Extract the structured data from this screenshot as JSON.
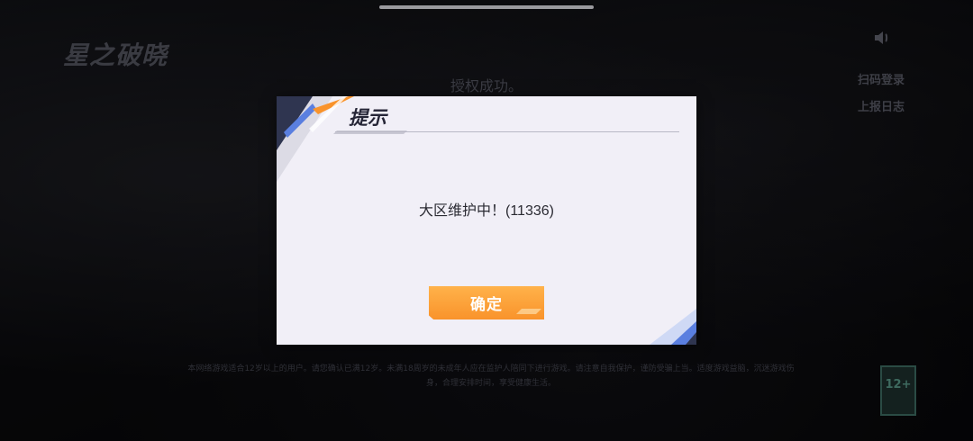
{
  "background": {
    "logo_text": "星之破晓",
    "auth_status": "授权成功。",
    "side_links": [
      "扫码登录",
      "上报日志"
    ],
    "agreement_text": "本网络游戏适合12岁以上的用户。请您确认已满12岁。未满18周岁的未成年人应在监护人陪同下进行游戏。请注意自我保护，谨防受骗上当。适度游戏益脑，沉迷游戏伤身，合理安排时间，享受健康生活。",
    "age_rating": "12+"
  },
  "dialog": {
    "title": "提示",
    "message": "大区维护中！(11336)",
    "confirm_label": "确定"
  },
  "colors": {
    "accent_orange": "#f9932b",
    "accent_blue": "#5a7fe0",
    "dialog_bg": "#f1eff7"
  },
  "icons": [
    "speaker-icon"
  ]
}
